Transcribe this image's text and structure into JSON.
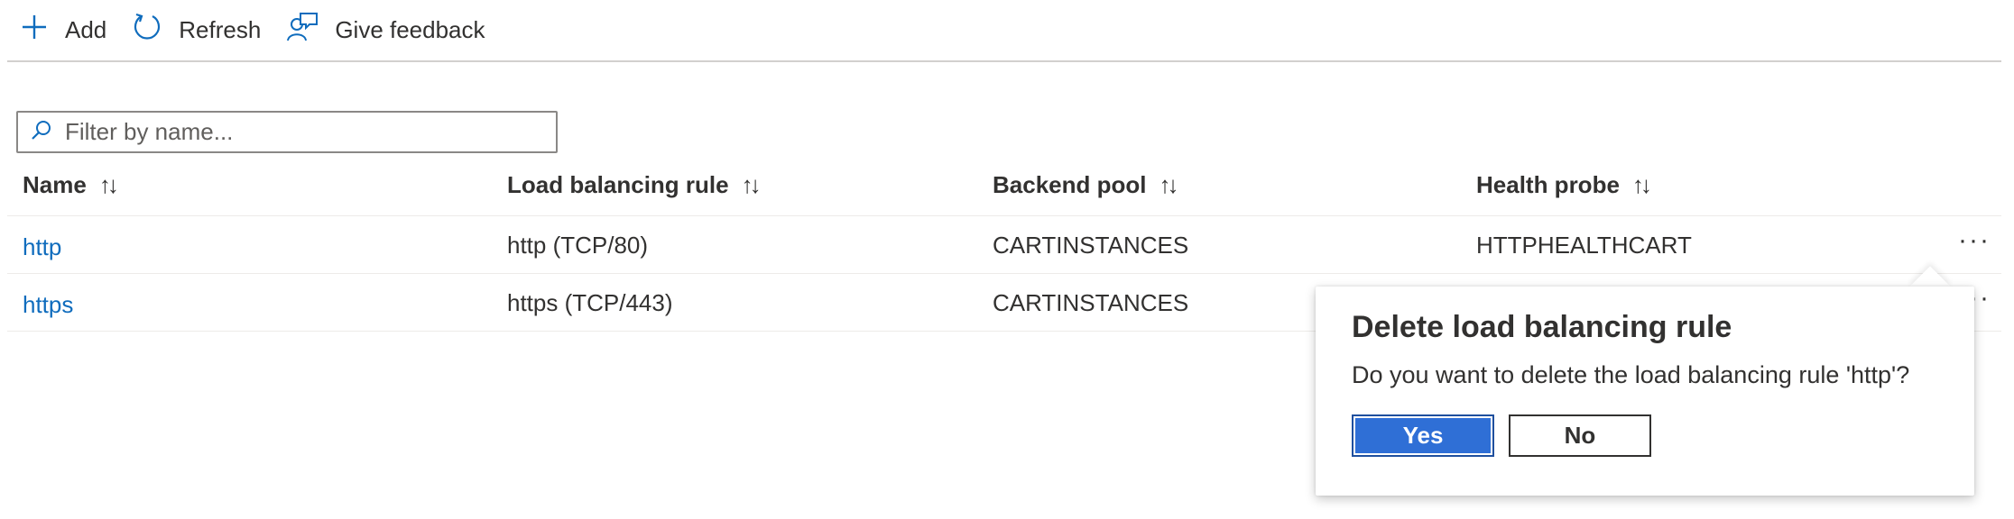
{
  "toolbar": {
    "add_label": "Add",
    "refresh_label": "Refresh",
    "feedback_label": "Give feedback"
  },
  "filter": {
    "placeholder": "Filter by name...",
    "value": ""
  },
  "table": {
    "columns": [
      "Name",
      "Load balancing rule",
      "Backend pool",
      "Health probe"
    ],
    "sort_glyph": "↑↓",
    "rows": [
      {
        "name": "http",
        "rule": "http (TCP/80)",
        "pool": "CARTINSTANCES",
        "probe": "HTTPHEALTHCART"
      },
      {
        "name": "https",
        "rule": "https (TCP/443)",
        "pool": "CARTINSTANCES",
        "probe": ""
      }
    ],
    "more_glyph": "···"
  },
  "dialog": {
    "title": "Delete load balancing rule",
    "message": "Do you want to delete the load balancing rule 'http'?",
    "yes_label": "Yes",
    "no_label": "No"
  },
  "colors": {
    "accent": "#0f6cbd",
    "primary_button": "#2f6fd6",
    "text": "#323130",
    "border": "#8a8886"
  },
  "icons": [
    "plus-icon",
    "refresh-icon",
    "feedback-icon",
    "search-icon",
    "more-icon"
  ]
}
